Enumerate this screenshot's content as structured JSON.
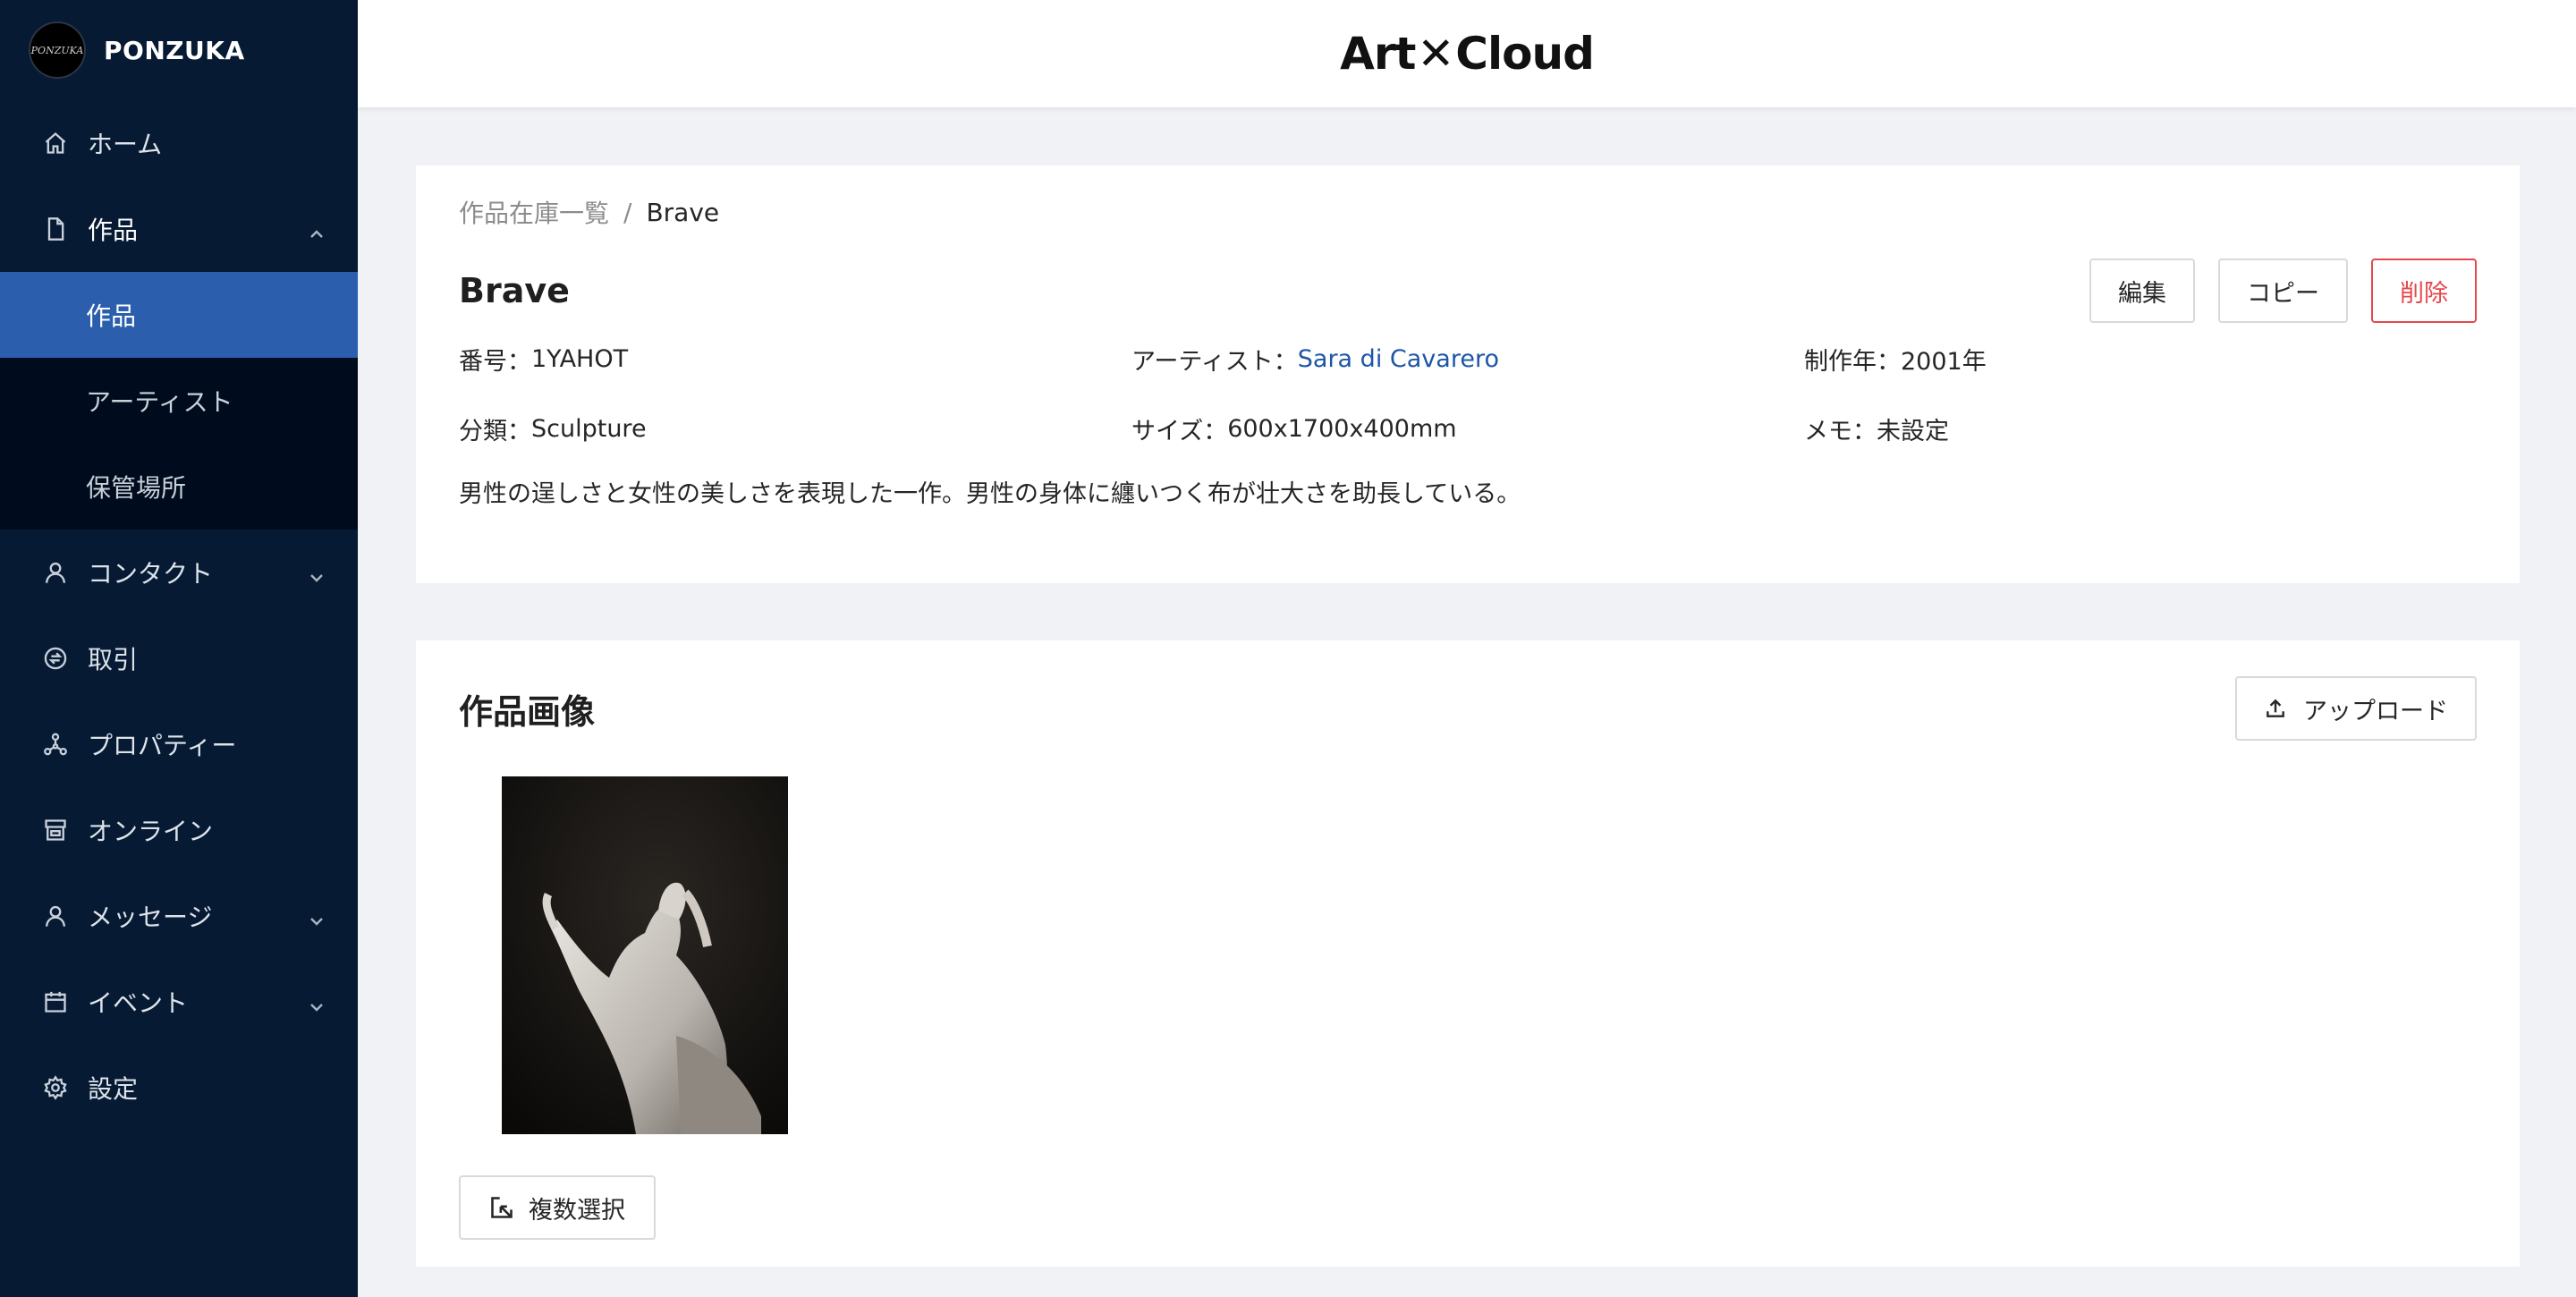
{
  "sidebar": {
    "brand_logo_text": "PONZUKA",
    "brand_name": "PONZUKA",
    "items": [
      {
        "label": "ホーム",
        "icon": "home-icon"
      },
      {
        "label": "作品",
        "icon": "file-icon"
      },
      {
        "label": "コンタクト",
        "icon": "user-icon"
      },
      {
        "label": "取引",
        "icon": "transaction-icon"
      },
      {
        "label": "プロパティー",
        "icon": "network-icon"
      },
      {
        "label": "オンライン",
        "icon": "store-icon"
      },
      {
        "label": "メッセージ",
        "icon": "user-icon"
      },
      {
        "label": "イベント",
        "icon": "calendar-icon"
      },
      {
        "label": "設定",
        "icon": "gear-icon"
      }
    ],
    "sub_items": [
      {
        "label": "作品",
        "active": true
      },
      {
        "label": "アーティスト",
        "active": false
      },
      {
        "label": "保管場所",
        "active": false
      }
    ]
  },
  "header": {
    "logo_left": "Art",
    "logo_x": "✕",
    "logo_right": "Cloud"
  },
  "detail": {
    "breadcrumb_parent": "作品在庫一覧",
    "breadcrumb_sep": "/",
    "breadcrumb_current": "Brave",
    "title": "Brave",
    "edit_label": "編集",
    "copy_label": "コピー",
    "delete_label": "削除",
    "number_key": "番号：",
    "number_value": "1YAHOT",
    "artist_key": "アーティスト：",
    "artist_value": "Sara di Cavarero",
    "year_key": "制作年：",
    "year_value": "2001年",
    "category_key": "分類：",
    "category_value": "Sculpture",
    "size_key": "サイズ：",
    "size_value": "600x1700x400mm",
    "memo_key": "メモ：",
    "memo_value": "未設定",
    "description": "男性の逞しさと女性の美しさを表現した一作。男性の身体に纏いつく布が壮大さを助長している。"
  },
  "images": {
    "title": "作品画像",
    "upload_label": "アップロード",
    "multi_select_label": "複数選択"
  },
  "colors": {
    "sidebar_bg": "#061a33",
    "active_item": "#2b5fae",
    "link": "#1d56a7",
    "danger": "#e5484d"
  }
}
